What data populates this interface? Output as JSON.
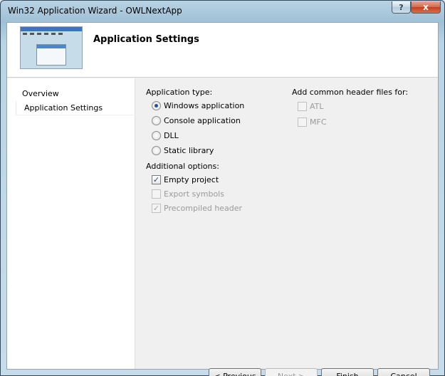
{
  "window": {
    "title": "Win32 Application Wizard - OWLNextApp",
    "help_glyph": "?",
    "close_glyph": "x"
  },
  "header": {
    "title": "Application Settings",
    "thumbnail_icon": "window-thumbnail-icon"
  },
  "nav": {
    "items": [
      {
        "label": "Overview",
        "selected": false
      },
      {
        "label": "Application Settings",
        "selected": true
      }
    ]
  },
  "app_type": {
    "label": "Application type:",
    "options": [
      {
        "label": "Windows application",
        "checked": true
      },
      {
        "label": "Console application",
        "checked": false
      },
      {
        "label": "DLL",
        "checked": false
      },
      {
        "label": "Static library",
        "checked": false
      }
    ]
  },
  "additional": {
    "label": "Additional options:",
    "options": [
      {
        "label": "Empty project",
        "checked": true,
        "enabled": true
      },
      {
        "label": "Export symbols",
        "checked": false,
        "enabled": false
      },
      {
        "label": "Precompiled header",
        "checked": true,
        "enabled": false
      }
    ]
  },
  "headers": {
    "label": "Add common header files for:",
    "options": [
      {
        "label": "ATL",
        "checked": false,
        "enabled": false
      },
      {
        "label": "MFC",
        "checked": false,
        "enabled": false
      }
    ]
  },
  "buttons": {
    "previous": "< Previous",
    "next": "Next >",
    "finish": "Finish",
    "cancel": "Cancel"
  }
}
